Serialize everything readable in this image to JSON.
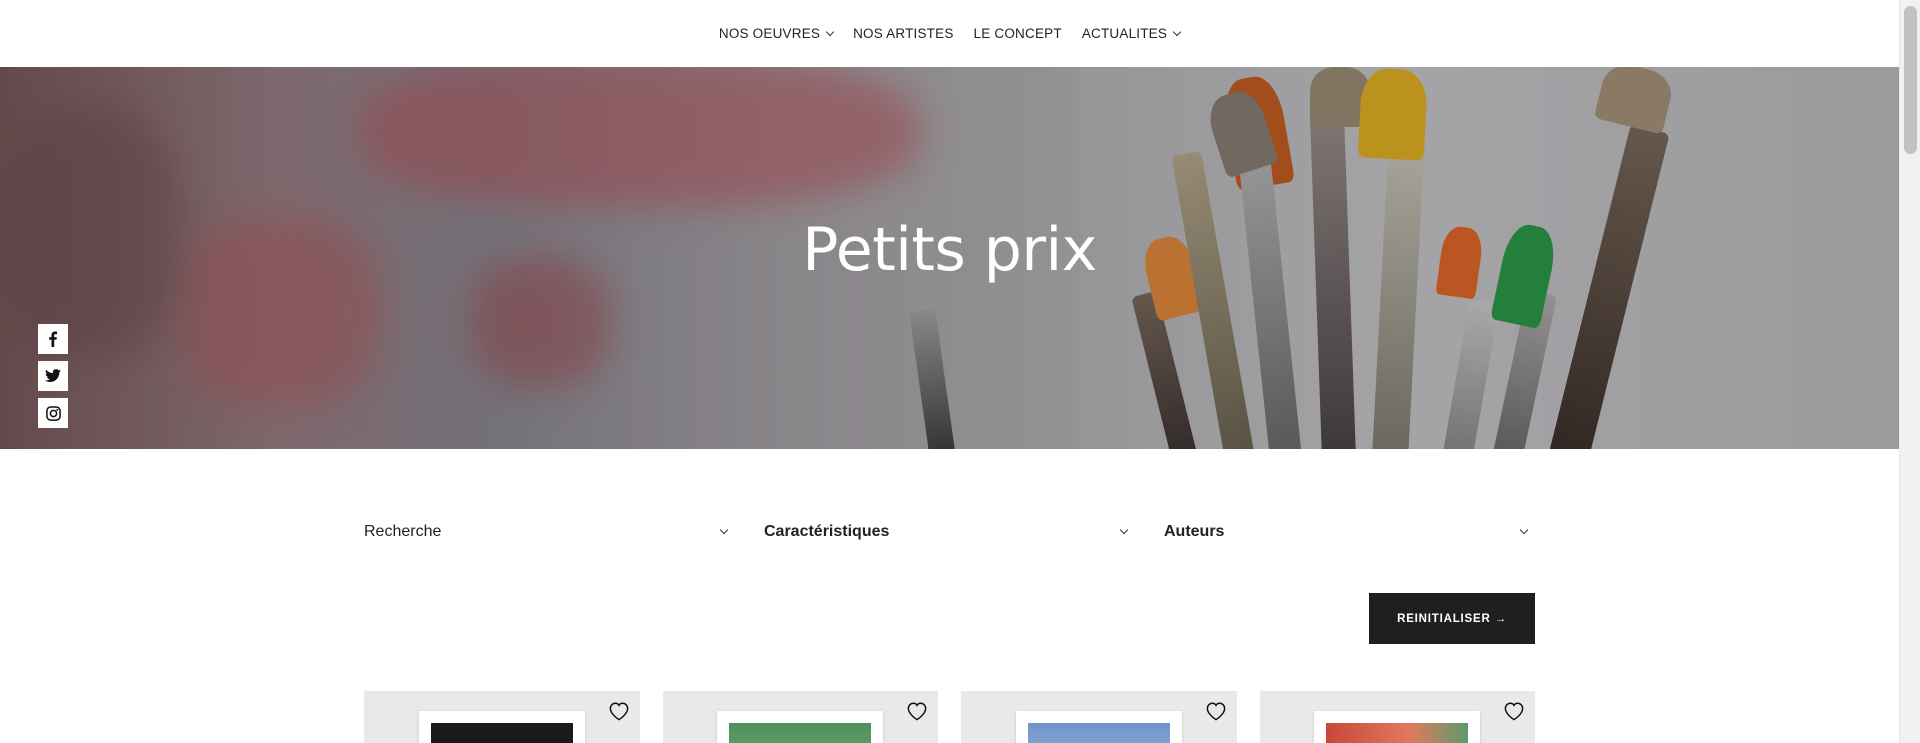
{
  "nav": {
    "items": [
      {
        "label": "NOS OEUVRES",
        "has_dropdown": true
      },
      {
        "label": "NOS ARTISTES",
        "has_dropdown": false
      },
      {
        "label": "LE CONCEPT",
        "has_dropdown": false
      },
      {
        "label": "ACTUALITES",
        "has_dropdown": true
      }
    ]
  },
  "hero": {
    "title": "Petits prix"
  },
  "social": {
    "icons": [
      "facebook-icon",
      "twitter-icon",
      "instagram-icon"
    ]
  },
  "filters": {
    "search_label": "Recherche",
    "characteristics_label": "Caractéristiques",
    "authors_label": "Auteurs"
  },
  "reset": {
    "label": "REINITIALISER →"
  },
  "products": [
    {
      "art_color": "#1a1a1a",
      "icon": "heart-icon"
    },
    {
      "art_color": "#4f8f5a",
      "icon": "heart-icon"
    },
    {
      "art_color": "#6f93c9",
      "icon": "heart-icon"
    },
    {
      "art_color": "#c8473a",
      "icon": "heart-icon"
    }
  ],
  "colors": {
    "accent_dark": "#1f1f1f",
    "card_bg": "#e9e9e9"
  }
}
